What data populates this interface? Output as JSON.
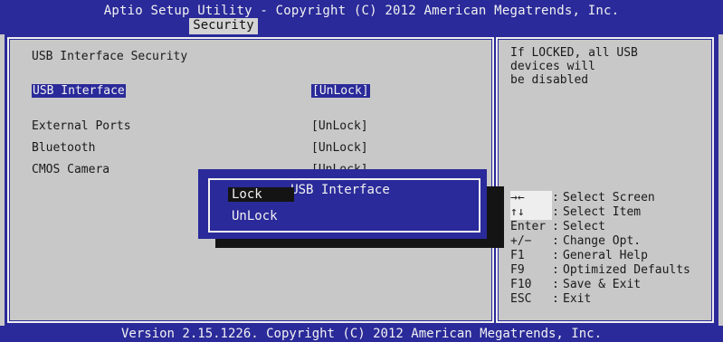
{
  "header": {
    "title": "Aptio Setup Utility - Copyright (C) 2012 American Megatrends, Inc.",
    "active_tab": "Security"
  },
  "main": {
    "section_title": "USB Interface Security",
    "settings": [
      {
        "label": "USB Interface",
        "value": "[UnLock]"
      },
      {
        "label": "External Ports",
        "value": "[UnLock]"
      },
      {
        "label": "Bluetooth",
        "value": "[UnLock]"
      },
      {
        "label": "CMOS Camera",
        "value": "[UnLock]"
      }
    ]
  },
  "help": {
    "lines": [
      "If LOCKED, all USB",
      "devices will",
      "be disabled"
    ],
    "keys": [
      {
        "key": "→←",
        "desc": "Select Screen"
      },
      {
        "key": "↑↓",
        "desc": "Select Item"
      },
      {
        "key": "Enter",
        "desc": "Select"
      },
      {
        "key": "+/−",
        "desc": "Change Opt."
      },
      {
        "key": "F1",
        "desc": "General Help"
      },
      {
        "key": "F9",
        "desc": "Optimized Defaults"
      },
      {
        "key": "F10",
        "desc": "Save & Exit"
      },
      {
        "key": "ESC",
        "desc": "Exit"
      }
    ]
  },
  "popup": {
    "title": "USB Interface",
    "options": [
      "Lock",
      "UnLock"
    ],
    "selected": "Lock"
  },
  "footer": {
    "version": "Version 2.15.1226. Copyright (C) 2012 American Megatrends, Inc."
  },
  "colors": {
    "frame_blue": "#2a2a9a",
    "panel_gray": "#c8c8c8",
    "text_light": "#f2f2f2"
  }
}
